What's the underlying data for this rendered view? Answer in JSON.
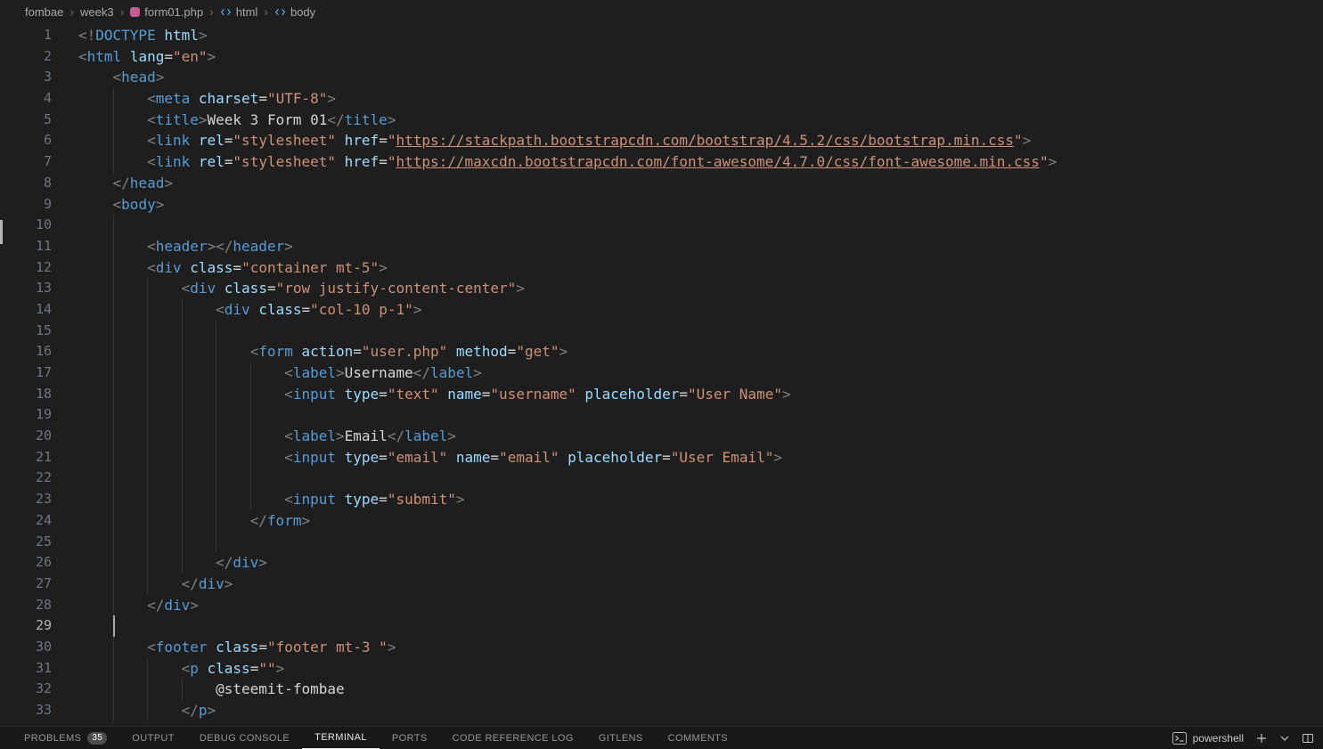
{
  "breadcrumbs": {
    "separator": "›",
    "items": [
      {
        "label": "fombae",
        "icon": ""
      },
      {
        "label": "week3",
        "icon": ""
      },
      {
        "label": "form01.php",
        "icon": "php"
      },
      {
        "label": "html",
        "icon": "tag"
      },
      {
        "label": "body",
        "icon": "tag"
      }
    ]
  },
  "editor": {
    "lines": [
      {
        "n": "1",
        "g": 0,
        "tk": [
          [
            "p",
            "<!"
          ],
          [
            "t",
            "DOCTYPE"
          ],
          [
            "w",
            " "
          ],
          [
            "a",
            "html"
          ],
          [
            "p",
            ">"
          ]
        ]
      },
      {
        "n": "2",
        "g": 0,
        "tk": [
          [
            "p",
            "<"
          ],
          [
            "t",
            "html"
          ],
          [
            "w",
            " "
          ],
          [
            "a",
            "lang"
          ],
          [
            "w",
            "="
          ],
          [
            "s",
            "\"en\""
          ],
          [
            "p",
            ">"
          ]
        ]
      },
      {
        "n": "3",
        "g": 0,
        "tk": [
          [
            "w",
            "    "
          ],
          [
            "p",
            "<"
          ],
          [
            "t",
            "head"
          ],
          [
            "p",
            ">"
          ]
        ]
      },
      {
        "n": "4",
        "g": 1,
        "tk": [
          [
            "w",
            "        "
          ],
          [
            "p",
            "<"
          ],
          [
            "t",
            "meta"
          ],
          [
            "w",
            " "
          ],
          [
            "a",
            "charset"
          ],
          [
            "w",
            "="
          ],
          [
            "s",
            "\"UTF-8\""
          ],
          [
            "p",
            ">"
          ]
        ]
      },
      {
        "n": "5",
        "g": 1,
        "tk": [
          [
            "w",
            "        "
          ],
          [
            "p",
            "<"
          ],
          [
            "t",
            "title"
          ],
          [
            "p",
            ">"
          ],
          [
            "w",
            "Week 3 Form 01"
          ],
          [
            "p",
            "</"
          ],
          [
            "t",
            "title"
          ],
          [
            "p",
            ">"
          ]
        ]
      },
      {
        "n": "6",
        "g": 1,
        "tk": [
          [
            "w",
            "        "
          ],
          [
            "p",
            "<"
          ],
          [
            "t",
            "link"
          ],
          [
            "w",
            " "
          ],
          [
            "a",
            "rel"
          ],
          [
            "w",
            "="
          ],
          [
            "s",
            "\"stylesheet\""
          ],
          [
            "w",
            " "
          ],
          [
            "a",
            "href"
          ],
          [
            "w",
            "="
          ],
          [
            "s",
            "\""
          ],
          [
            "u",
            "https://stackpath.bootstrapcdn.com/bootstrap/4.5.2/css/bootstrap.min.css"
          ],
          [
            "s",
            "\""
          ],
          [
            "p",
            ">"
          ]
        ]
      },
      {
        "n": "7",
        "g": 1,
        "tk": [
          [
            "w",
            "        "
          ],
          [
            "p",
            "<"
          ],
          [
            "t",
            "link"
          ],
          [
            "w",
            " "
          ],
          [
            "a",
            "rel"
          ],
          [
            "w",
            "="
          ],
          [
            "s",
            "\"stylesheet\""
          ],
          [
            "w",
            " "
          ],
          [
            "a",
            "href"
          ],
          [
            "w",
            "="
          ],
          [
            "s",
            "\""
          ],
          [
            "u",
            "https://maxcdn.bootstrapcdn.com/font-awesome/4.7.0/css/font-awesome.min.css"
          ],
          [
            "s",
            "\""
          ],
          [
            "p",
            ">"
          ]
        ]
      },
      {
        "n": "8",
        "g": 0,
        "tk": [
          [
            "w",
            "    "
          ],
          [
            "p",
            "</"
          ],
          [
            "t",
            "head"
          ],
          [
            "p",
            ">"
          ]
        ]
      },
      {
        "n": "9",
        "g": 0,
        "tk": [
          [
            "w",
            "    "
          ],
          [
            "p",
            "<"
          ],
          [
            "t",
            "body"
          ],
          [
            "p",
            ">"
          ]
        ]
      },
      {
        "n": "10",
        "g": 1,
        "tk": []
      },
      {
        "n": "11",
        "g": 1,
        "tk": [
          [
            "w",
            "        "
          ],
          [
            "p",
            "<"
          ],
          [
            "t",
            "header"
          ],
          [
            "p",
            "></"
          ],
          [
            "t",
            "header"
          ],
          [
            "p",
            ">"
          ]
        ]
      },
      {
        "n": "12",
        "g": 1,
        "tk": [
          [
            "w",
            "        "
          ],
          [
            "p",
            "<"
          ],
          [
            "t",
            "div"
          ],
          [
            "w",
            " "
          ],
          [
            "a",
            "class"
          ],
          [
            "w",
            "="
          ],
          [
            "s",
            "\"container mt-5\""
          ],
          [
            "p",
            ">"
          ]
        ]
      },
      {
        "n": "13",
        "g": 2,
        "tk": [
          [
            "w",
            "            "
          ],
          [
            "p",
            "<"
          ],
          [
            "t",
            "div"
          ],
          [
            "w",
            " "
          ],
          [
            "a",
            "class"
          ],
          [
            "w",
            "="
          ],
          [
            "s",
            "\"row justify-content-center\""
          ],
          [
            "p",
            ">"
          ]
        ]
      },
      {
        "n": "14",
        "g": 3,
        "tk": [
          [
            "w",
            "                "
          ],
          [
            "p",
            "<"
          ],
          [
            "t",
            "div"
          ],
          [
            "w",
            " "
          ],
          [
            "a",
            "class"
          ],
          [
            "w",
            "="
          ],
          [
            "s",
            "\"col-10 p-1\""
          ],
          [
            "p",
            ">"
          ]
        ]
      },
      {
        "n": "15",
        "g": 4,
        "tk": []
      },
      {
        "n": "16",
        "g": 4,
        "tk": [
          [
            "w",
            "                    "
          ],
          [
            "p",
            "<"
          ],
          [
            "t",
            "form"
          ],
          [
            "w",
            " "
          ],
          [
            "a",
            "action"
          ],
          [
            "w",
            "="
          ],
          [
            "s",
            "\"user.php\""
          ],
          [
            "w",
            " "
          ],
          [
            "a",
            "method"
          ],
          [
            "w",
            "="
          ],
          [
            "s",
            "\"get\""
          ],
          [
            "p",
            ">"
          ]
        ]
      },
      {
        "n": "17",
        "g": 5,
        "tk": [
          [
            "w",
            "                        "
          ],
          [
            "p",
            "<"
          ],
          [
            "t",
            "label"
          ],
          [
            "p",
            ">"
          ],
          [
            "w",
            "Username"
          ],
          [
            "p",
            "</"
          ],
          [
            "t",
            "label"
          ],
          [
            "p",
            ">"
          ]
        ]
      },
      {
        "n": "18",
        "g": 5,
        "tk": [
          [
            "w",
            "                        "
          ],
          [
            "p",
            "<"
          ],
          [
            "t",
            "input"
          ],
          [
            "w",
            " "
          ],
          [
            "a",
            "type"
          ],
          [
            "w",
            "="
          ],
          [
            "s",
            "\"text\""
          ],
          [
            "w",
            " "
          ],
          [
            "a",
            "name"
          ],
          [
            "w",
            "="
          ],
          [
            "s",
            "\"username\""
          ],
          [
            "w",
            " "
          ],
          [
            "a",
            "placeholder"
          ],
          [
            "w",
            "="
          ],
          [
            "s",
            "\"User Name\""
          ],
          [
            "p",
            ">"
          ]
        ]
      },
      {
        "n": "19",
        "g": 5,
        "tk": []
      },
      {
        "n": "20",
        "g": 5,
        "tk": [
          [
            "w",
            "                        "
          ],
          [
            "p",
            "<"
          ],
          [
            "t",
            "label"
          ],
          [
            "p",
            ">"
          ],
          [
            "w",
            "Email"
          ],
          [
            "p",
            "</"
          ],
          [
            "t",
            "label"
          ],
          [
            "p",
            ">"
          ]
        ]
      },
      {
        "n": "21",
        "g": 5,
        "tk": [
          [
            "w",
            "                        "
          ],
          [
            "p",
            "<"
          ],
          [
            "t",
            "input"
          ],
          [
            "w",
            " "
          ],
          [
            "a",
            "type"
          ],
          [
            "w",
            "="
          ],
          [
            "s",
            "\"email\""
          ],
          [
            "w",
            " "
          ],
          [
            "a",
            "name"
          ],
          [
            "w",
            "="
          ],
          [
            "s",
            "\"email\""
          ],
          [
            "w",
            " "
          ],
          [
            "a",
            "placeholder"
          ],
          [
            "w",
            "="
          ],
          [
            "s",
            "\"User Email\""
          ],
          [
            "p",
            ">"
          ]
        ]
      },
      {
        "n": "22",
        "g": 5,
        "tk": []
      },
      {
        "n": "23",
        "g": 5,
        "tk": [
          [
            "w",
            "                        "
          ],
          [
            "p",
            "<"
          ],
          [
            "t",
            "input"
          ],
          [
            "w",
            " "
          ],
          [
            "a",
            "type"
          ],
          [
            "w",
            "="
          ],
          [
            "s",
            "\"submit\""
          ],
          [
            "p",
            ">"
          ]
        ]
      },
      {
        "n": "24",
        "g": 4,
        "tk": [
          [
            "w",
            "                    "
          ],
          [
            "p",
            "</"
          ],
          [
            "t",
            "form"
          ],
          [
            "p",
            ">"
          ]
        ]
      },
      {
        "n": "25",
        "g": 4,
        "tk": []
      },
      {
        "n": "26",
        "g": 3,
        "tk": [
          [
            "w",
            "                "
          ],
          [
            "p",
            "</"
          ],
          [
            "t",
            "div"
          ],
          [
            "p",
            ">"
          ]
        ]
      },
      {
        "n": "27",
        "g": 2,
        "tk": [
          [
            "w",
            "            "
          ],
          [
            "p",
            "</"
          ],
          [
            "t",
            "div"
          ],
          [
            "p",
            ">"
          ]
        ]
      },
      {
        "n": "28",
        "g": 1,
        "tk": [
          [
            "w",
            "        "
          ],
          [
            "p",
            "</"
          ],
          [
            "t",
            "div"
          ],
          [
            "p",
            ">"
          ]
        ]
      },
      {
        "n": "29",
        "g": 1,
        "ag": true,
        "tk": []
      },
      {
        "n": "30",
        "g": 1,
        "tk": [
          [
            "w",
            "        "
          ],
          [
            "p",
            "<"
          ],
          [
            "t",
            "footer"
          ],
          [
            "w",
            " "
          ],
          [
            "a",
            "class"
          ],
          [
            "w",
            "="
          ],
          [
            "s",
            "\"footer mt-3 \""
          ],
          [
            "p",
            ">"
          ]
        ]
      },
      {
        "n": "31",
        "g": 2,
        "tk": [
          [
            "w",
            "            "
          ],
          [
            "p",
            "<"
          ],
          [
            "t",
            "p"
          ],
          [
            "w",
            " "
          ],
          [
            "a",
            "class"
          ],
          [
            "w",
            "="
          ],
          [
            "s",
            "\"\""
          ],
          [
            "p",
            ">"
          ]
        ]
      },
      {
        "n": "32",
        "g": 3,
        "tk": [
          [
            "w",
            "                "
          ],
          [
            "w",
            "@steemit-fombae"
          ]
        ]
      },
      {
        "n": "33",
        "g": 2,
        "tk": [
          [
            "w",
            "            "
          ],
          [
            "p",
            "</"
          ],
          [
            "t",
            "p"
          ],
          [
            "p",
            ">"
          ]
        ]
      }
    ]
  },
  "panel": {
    "tabs": [
      {
        "label": "PROBLEMS",
        "badge": "35"
      },
      {
        "label": "OUTPUT"
      },
      {
        "label": "DEBUG CONSOLE"
      },
      {
        "label": "TERMINAL",
        "active": true
      },
      {
        "label": "PORTS"
      },
      {
        "label": "CODE REFERENCE LOG"
      },
      {
        "label": "GITLENS"
      },
      {
        "label": "COMMENTS"
      }
    ],
    "terminal": {
      "shell": "powershell"
    },
    "right_icons": [
      "plus-icon",
      "chevron-down-icon",
      "split-terminal-icon"
    ]
  },
  "palette": {
    "background": "#1e1e1e",
    "panel_background": "#181818",
    "tag": "#569cd6",
    "attribute": "#9cdcfe",
    "string": "#ce9178",
    "punctuation": "#808080",
    "text": "#d4d4d4",
    "line_number": "#6e7681",
    "breadcrumb_text": "#a9a9a9"
  }
}
